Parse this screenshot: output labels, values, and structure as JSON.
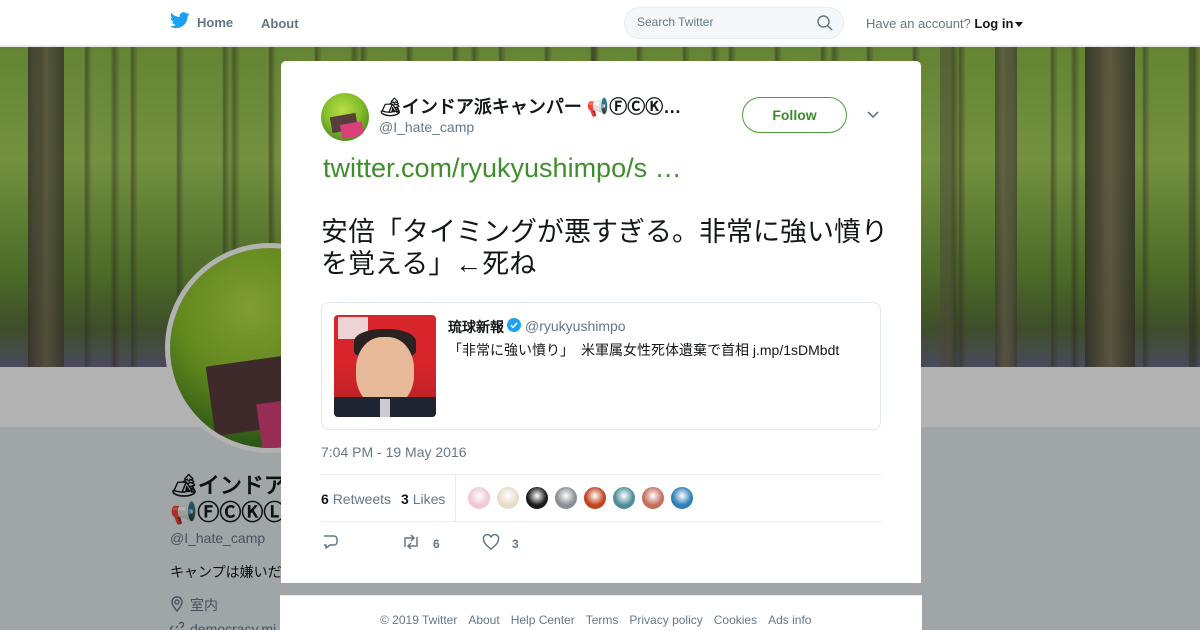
{
  "nav": {
    "home_label": "Home",
    "about_label": "About",
    "search_placeholder": "Search Twitter",
    "account_prompt": "Have an account?",
    "login_label": "Log in"
  },
  "profile": {
    "name_line1": "🏕インドア",
    "name_line2": "📢ⒻⒸⓀⓁ",
    "handle": "@I_hate_camp",
    "bio": "キャンプは嫌いだ",
    "location": "室内",
    "url": "democracy.mi"
  },
  "tweet": {
    "author_name": "🏕インドア派キャンパー 📢ⒻⒸⓀ…",
    "author_handle": "@I_hate_camp",
    "follow_label": "Follow",
    "link": "twitter.com/ryukyushimpo/s …",
    "text": "安倍「タイミングが悪すぎる。非常に強い憤りを覚える」←死ね",
    "timestamp": "7:04 PM - 19 May 2016",
    "retweets_count": "6",
    "retweets_label": "Retweets",
    "likes_count": "3",
    "likes_label": "Likes",
    "reply_count": "",
    "retweet_action_count": "6",
    "like_action_count": "3",
    "quoted": {
      "name": "琉球新報",
      "handle": "@ryukyushimpo",
      "text": "「非常に強い憤り」　米軍属女性死体遺棄で首相 j.mp/1sDMbdt"
    }
  },
  "likers": [
    "#f0c8d8",
    "#e8dcc6",
    "#1b1b1b",
    "#8a8f94",
    "#c0441e",
    "#4f8d9a",
    "#c46e5e",
    "#2f7fb8"
  ],
  "footer": {
    "links": [
      "© 2019 Twitter",
      "About",
      "Help Center",
      "Terms",
      "Privacy policy",
      "Cookies",
      "Ads info"
    ]
  },
  "colors": {
    "accent": "#3f8d2d",
    "twitter_blue": "#1da1f2"
  }
}
